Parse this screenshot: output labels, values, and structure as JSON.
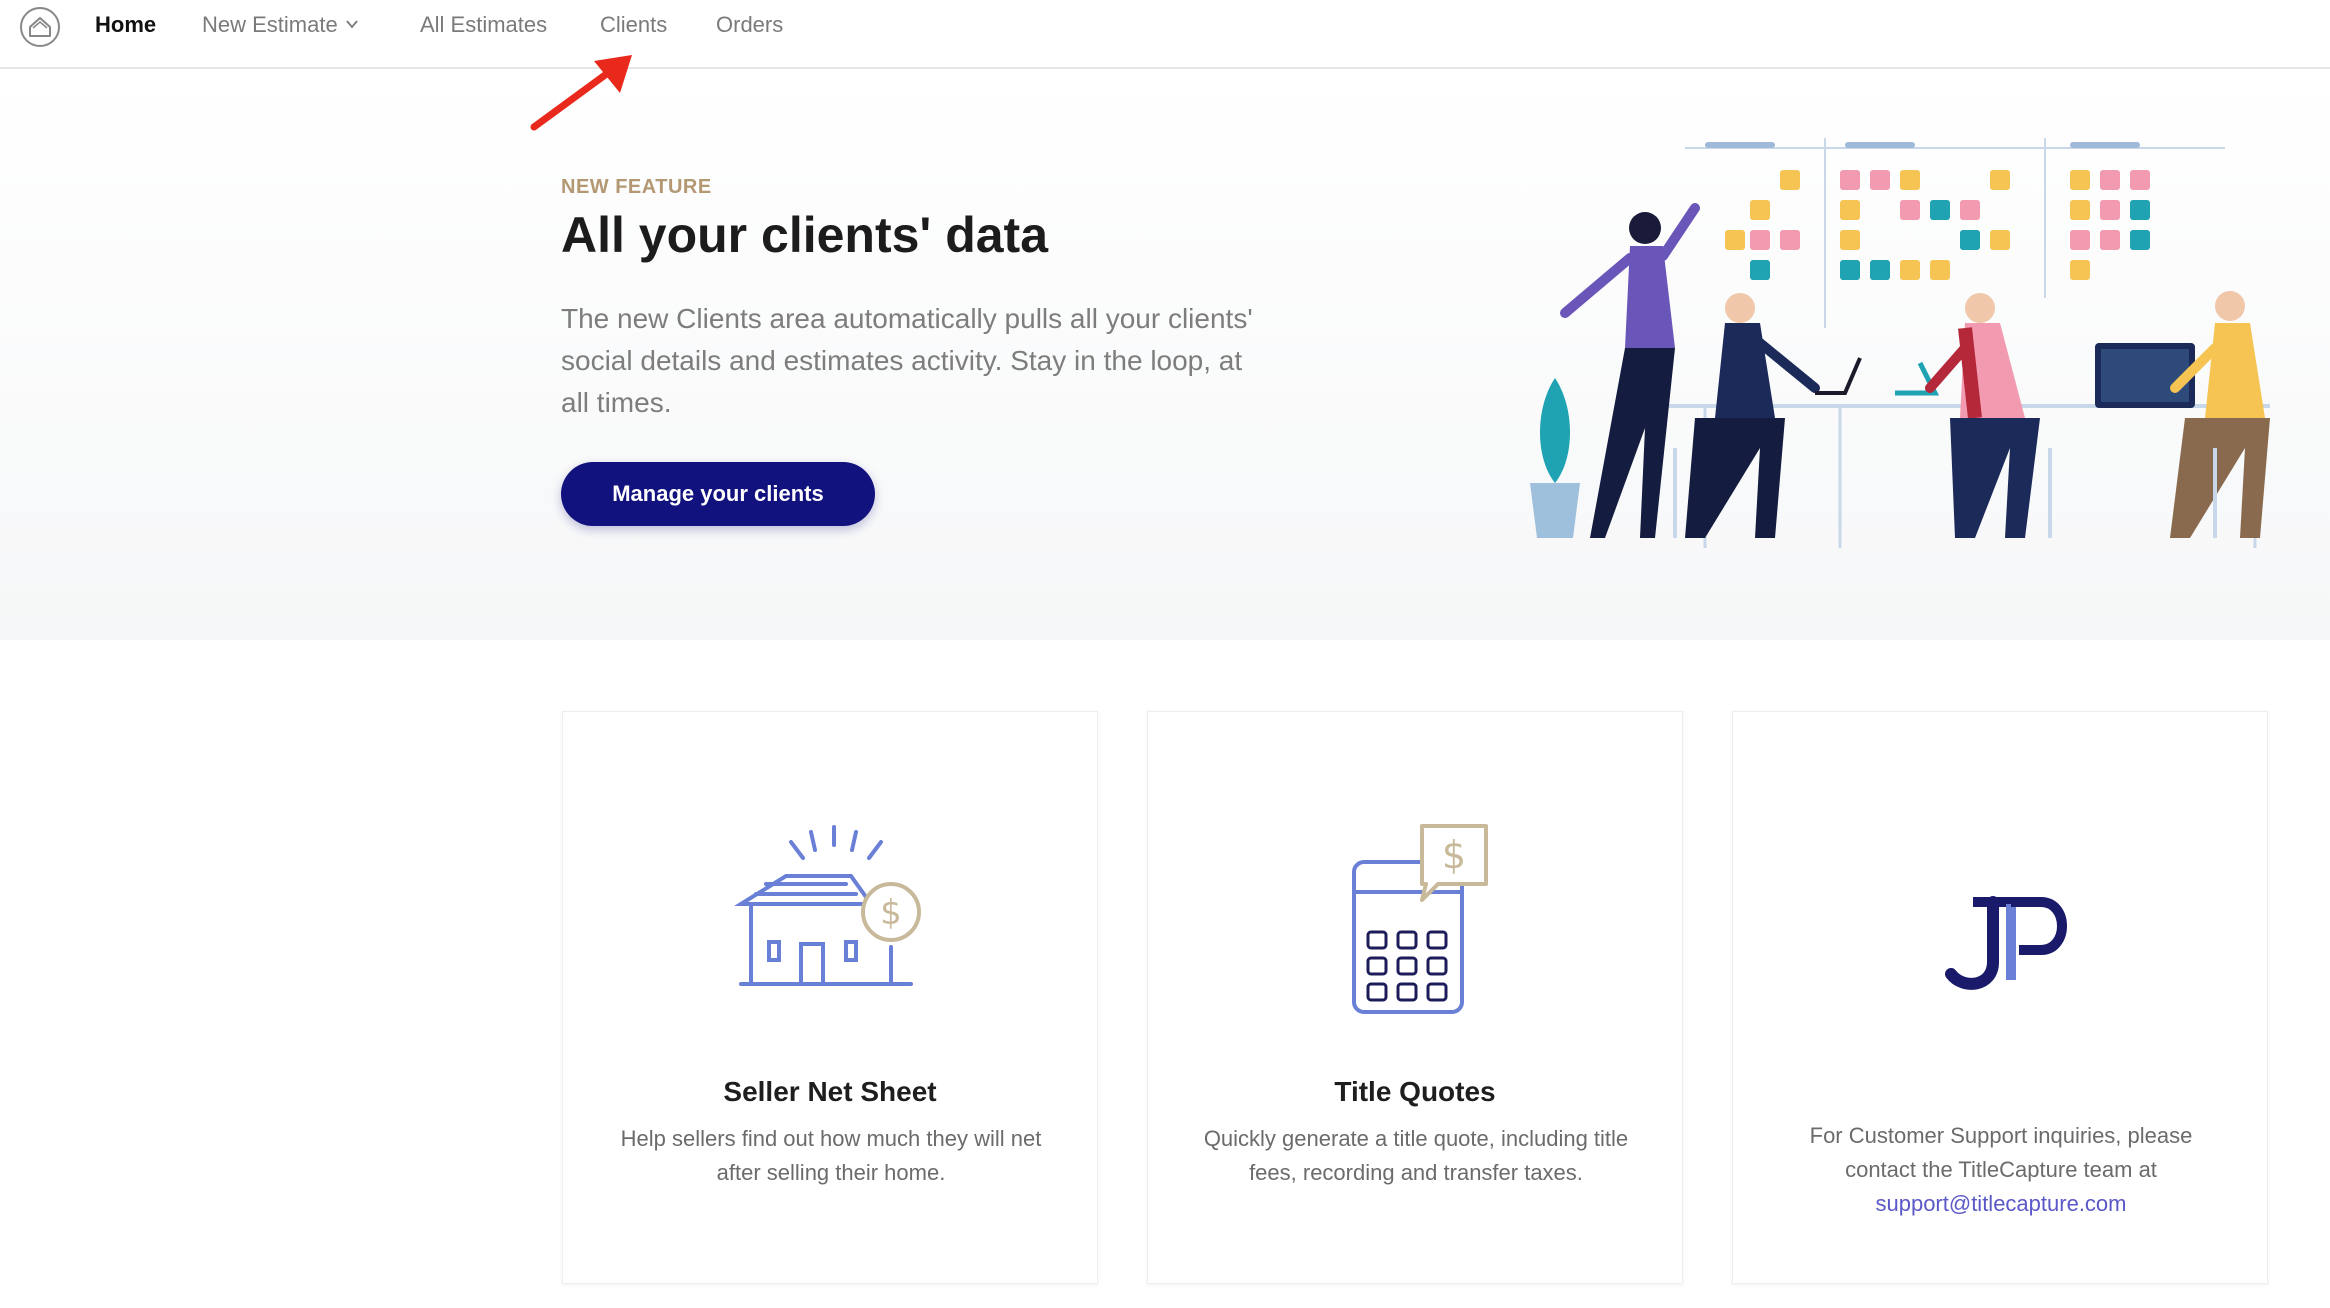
{
  "nav": {
    "home": "Home",
    "new_estimate": "New Estimate",
    "all_estimates": "All Estimates",
    "clients": "Clients",
    "orders": "Orders"
  },
  "hero": {
    "eyebrow": "NEW FEATURE",
    "title": "All your clients' data",
    "description": "The new Clients area automatically pulls all your clients' social details and estimates activity. Stay in the loop, at all times.",
    "cta_label": "Manage your clients"
  },
  "cards": [
    {
      "title": "Seller Net Sheet",
      "description": "Help sellers find out how much they will net after selling their home.",
      "icon": "house-dollar-icon"
    },
    {
      "title": "Title Quotes",
      "description": "Quickly generate a title quote, including title fees, recording and transfer taxes.",
      "icon": "calculator-dollar-icon"
    },
    {
      "title": "",
      "description": "For Customer Support inquiries, please contact the TitleCapture team at",
      "email": "support@titlecapture.com",
      "icon": "jp-logo"
    }
  ],
  "colors": {
    "primary_button": "#12127f",
    "eyebrow": "#b39873",
    "link": "#5b58c7",
    "arrow": "#e8291c"
  }
}
